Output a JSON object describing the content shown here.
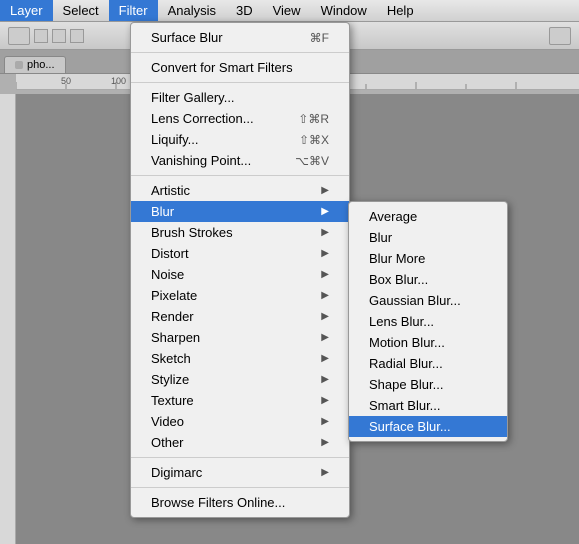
{
  "menubar": {
    "items": [
      {
        "label": "Layer",
        "active": false
      },
      {
        "label": "Select",
        "active": false
      },
      {
        "label": "Filter",
        "active": true
      },
      {
        "label": "Analysis",
        "active": false
      },
      {
        "label": "3D",
        "active": false
      },
      {
        "label": "View",
        "active": false
      },
      {
        "label": "Window",
        "active": false
      },
      {
        "label": "Help",
        "active": false
      }
    ]
  },
  "filter_menu": {
    "items": [
      {
        "label": "Surface Blur",
        "shortcut": "⌘F",
        "type": "item"
      },
      {
        "type": "separator"
      },
      {
        "label": "Convert for Smart Filters",
        "type": "item"
      },
      {
        "type": "separator"
      },
      {
        "label": "Filter Gallery...",
        "type": "item"
      },
      {
        "label": "Lens Correction...",
        "shortcut": "⇧⌘R",
        "type": "item"
      },
      {
        "label": "Liquify...",
        "shortcut": "⇧⌘X",
        "type": "item"
      },
      {
        "label": "Vanishing Point...",
        "shortcut": "⌥⌘V",
        "type": "item"
      },
      {
        "type": "separator"
      },
      {
        "label": "Artistic",
        "type": "submenu"
      },
      {
        "label": "Blur",
        "type": "submenu",
        "highlighted": true
      },
      {
        "label": "Brush Strokes",
        "type": "submenu"
      },
      {
        "label": "Distort",
        "type": "submenu"
      },
      {
        "label": "Noise",
        "type": "submenu"
      },
      {
        "label": "Pixelate",
        "type": "submenu"
      },
      {
        "label": "Render",
        "type": "submenu"
      },
      {
        "label": "Sharpen",
        "type": "submenu"
      },
      {
        "label": "Sketch",
        "type": "submenu"
      },
      {
        "label": "Stylize",
        "type": "submenu"
      },
      {
        "label": "Texture",
        "type": "submenu"
      },
      {
        "label": "Video",
        "type": "submenu"
      },
      {
        "label": "Other",
        "type": "submenu"
      },
      {
        "type": "separator"
      },
      {
        "label": "Digimarc",
        "type": "submenu"
      },
      {
        "type": "separator"
      },
      {
        "label": "Browse Filters Online...",
        "type": "item"
      }
    ]
  },
  "blur_submenu": {
    "items": [
      {
        "label": "Average"
      },
      {
        "label": "Blur"
      },
      {
        "label": "Blur More"
      },
      {
        "label": "Box Blur..."
      },
      {
        "label": "Gaussian Blur..."
      },
      {
        "label": "Lens Blur..."
      },
      {
        "label": "Motion Blur..."
      },
      {
        "label": "Radial Blur..."
      },
      {
        "label": "Shape Blur..."
      },
      {
        "label": "Smart Blur..."
      },
      {
        "label": "Surface Blur...",
        "highlighted": true
      }
    ]
  },
  "tab": {
    "label": "pho..."
  }
}
